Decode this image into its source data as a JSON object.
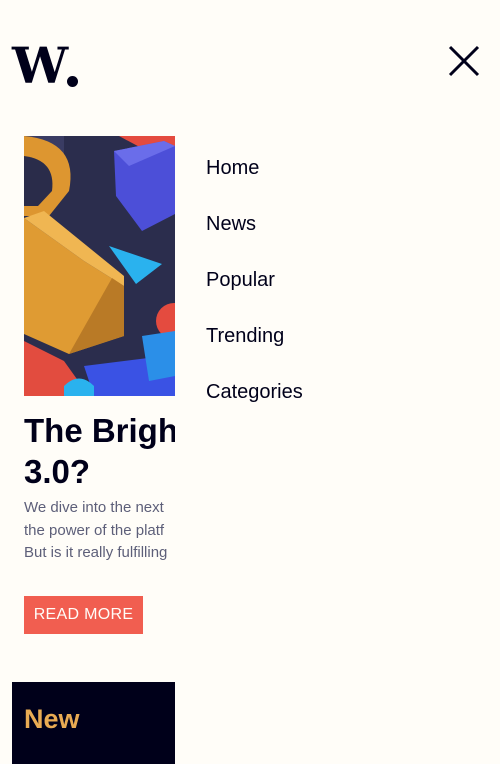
{
  "brand": {
    "logo_text": "W",
    "logo_icon": "w-logo-icon"
  },
  "header": {
    "close_icon": "close-icon"
  },
  "menu": {
    "items": [
      {
        "label": "Home"
      },
      {
        "label": "News"
      },
      {
        "label": "Popular"
      },
      {
        "label": "Trending"
      },
      {
        "label": "Categories"
      }
    ]
  },
  "featured": {
    "image_icon": "abstract-3d-blocks-image",
    "headline_lines": [
      "The Brigh",
      "3.0?"
    ],
    "excerpt_lines": [
      "We dive into the next",
      "the power of the platf",
      "But is it really fulfilling"
    ],
    "read_more_label": "READ MORE"
  },
  "sidebar_panel": {
    "title": "New"
  },
  "colors": {
    "background": "#fffdf8",
    "text": "#00001a",
    "accent_red": "#f15e50",
    "accent_orange": "#e9ab53",
    "muted_text": "#5d5f79"
  }
}
